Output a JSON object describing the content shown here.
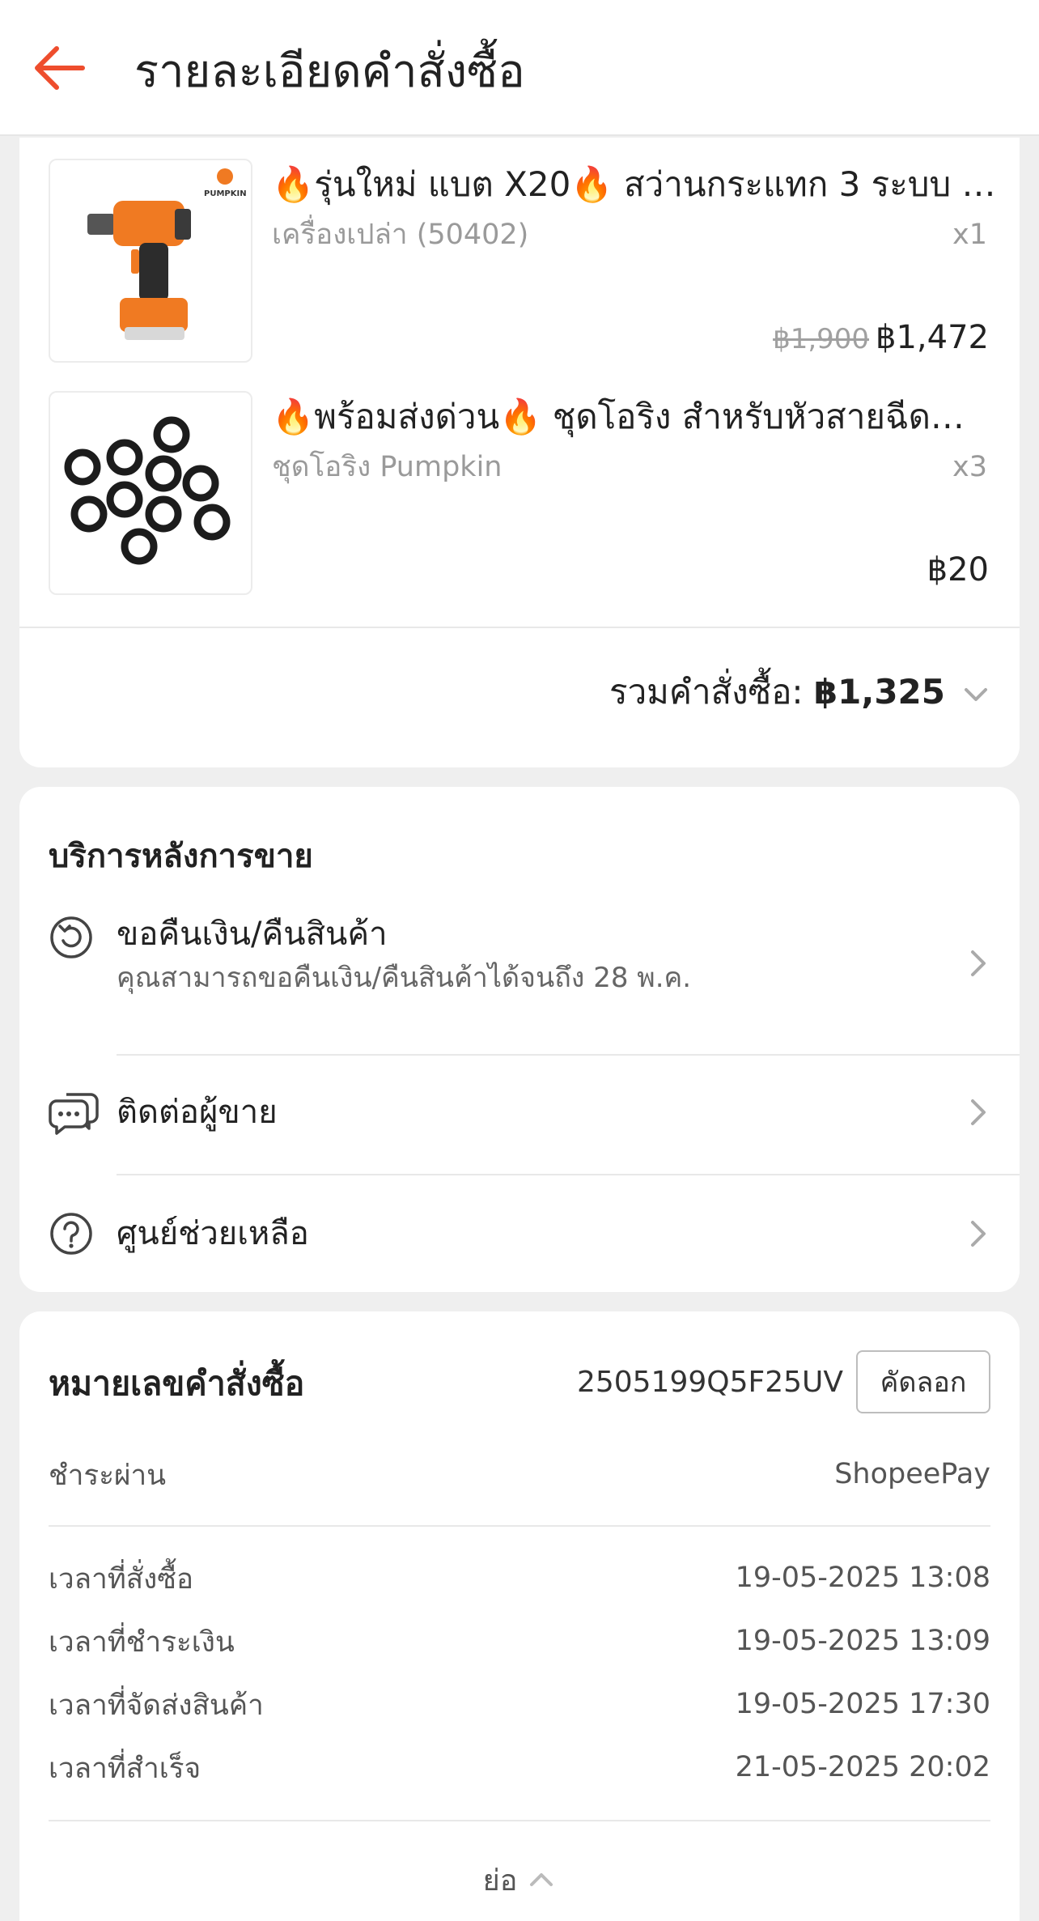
{
  "header": {
    "title": "รายละเอียดคำสั่งซื้อ",
    "back_icon": "arrow-left-icon",
    "accent_color": "#ee4d2d"
  },
  "products": [
    {
      "name": "🔥รุ่นใหม่ แบต X20🔥 สว่านกระแทก 3 ระบบ /...",
      "variant": "เครื่องเปล่า (50402)",
      "qty": "x1",
      "old_price": "฿1,900",
      "price": "฿1,472",
      "thumb_brand": "PUMPKIN"
    },
    {
      "name": "🔥พร้อมส่งด่วน🔥 ชุดโอริง สำหรับหัวสายฉีดน้ำ...",
      "variant": "ชุดโอริง Pumpkin",
      "qty": "x3",
      "old_price": "",
      "price": "฿20"
    }
  ],
  "order_total": {
    "label": "รวมคำสั่งซื้อ:",
    "amount": "฿1,325"
  },
  "after_sales": {
    "title": "บริการหลังการขาย",
    "items": [
      {
        "label": "ขอคืนเงิน/คืนสินค้า",
        "sub": "คุณสามารถขอคืนเงิน/คืนสินค้าได้จนถึง 28 พ.ค.",
        "icon": "return-icon"
      },
      {
        "label": "ติดต่อผู้ขาย",
        "sub": "",
        "icon": "chat-icon"
      },
      {
        "label": "ศูนย์ช่วยเหลือ",
        "sub": "",
        "icon": "help-icon"
      }
    ]
  },
  "order_info": {
    "order_no_label": "หมายเลขคำสั่งซื้อ",
    "order_no": "2505199Q5F25UV",
    "copy_label": "คัดลอก",
    "payment_label": "ชำระผ่าน",
    "payment_value": "ShopeePay",
    "times": [
      {
        "label": "เวลาที่สั่งซื้อ",
        "value": "19-05-2025 13:08"
      },
      {
        "label": "เวลาที่ชำระเงิน",
        "value": "19-05-2025 13:09"
      },
      {
        "label": "เวลาที่จัดส่งสินค้า",
        "value": "19-05-2025 17:30"
      },
      {
        "label": "เวลาที่สำเร็จ",
        "value": "21-05-2025 20:02"
      }
    ],
    "collapse_label": "ย่อ"
  }
}
